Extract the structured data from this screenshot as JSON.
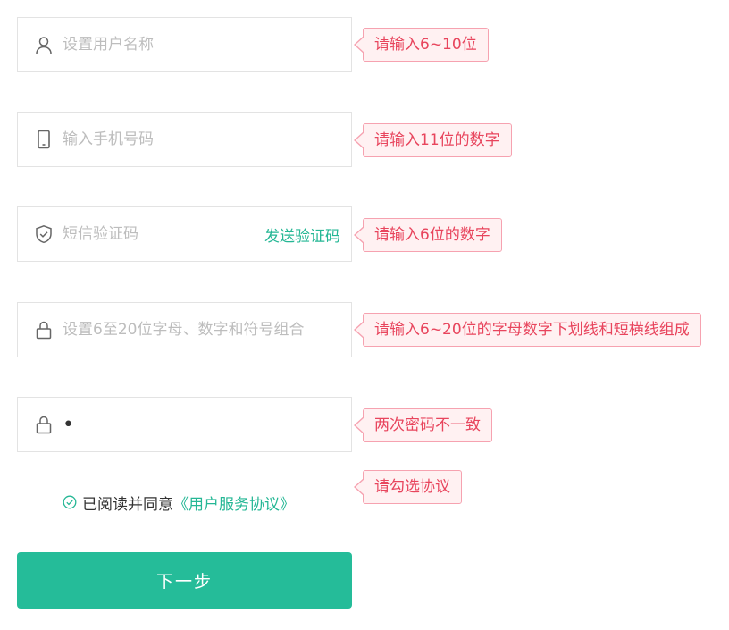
{
  "form": {
    "username": {
      "placeholder": "设置用户名称",
      "value": "",
      "icon": "user-icon"
    },
    "phone": {
      "placeholder": "输入手机号码",
      "value": "",
      "icon": "phone-icon"
    },
    "sms_code": {
      "placeholder": "短信验证码",
      "value": "",
      "icon": "shield-icon",
      "send_label": "发送验证码"
    },
    "password": {
      "placeholder": "设置6至20位字母、数字和符号组合",
      "value": "",
      "icon": "lock-icon"
    },
    "confirm_password": {
      "placeholder": "",
      "value": "•",
      "icon": "lock-icon"
    }
  },
  "tips": {
    "username": "请输入6~10位",
    "phone": "请输入11位的数字",
    "sms_code": "请输入6位的数字",
    "password": "请输入6~20位的字母数字下划线和短横线组成",
    "confirm_password": "两次密码不一致",
    "agreement": "请勾选协议"
  },
  "agreement": {
    "text": "已阅读并同意",
    "link": "《用户服务协议》",
    "icon": "check-circle-icon"
  },
  "next_button": {
    "label": "下一步"
  },
  "colors": {
    "accent": "#25bc99",
    "error_text": "#e8455d",
    "error_bg": "#fff1f2",
    "error_border": "#f6a2b0"
  }
}
